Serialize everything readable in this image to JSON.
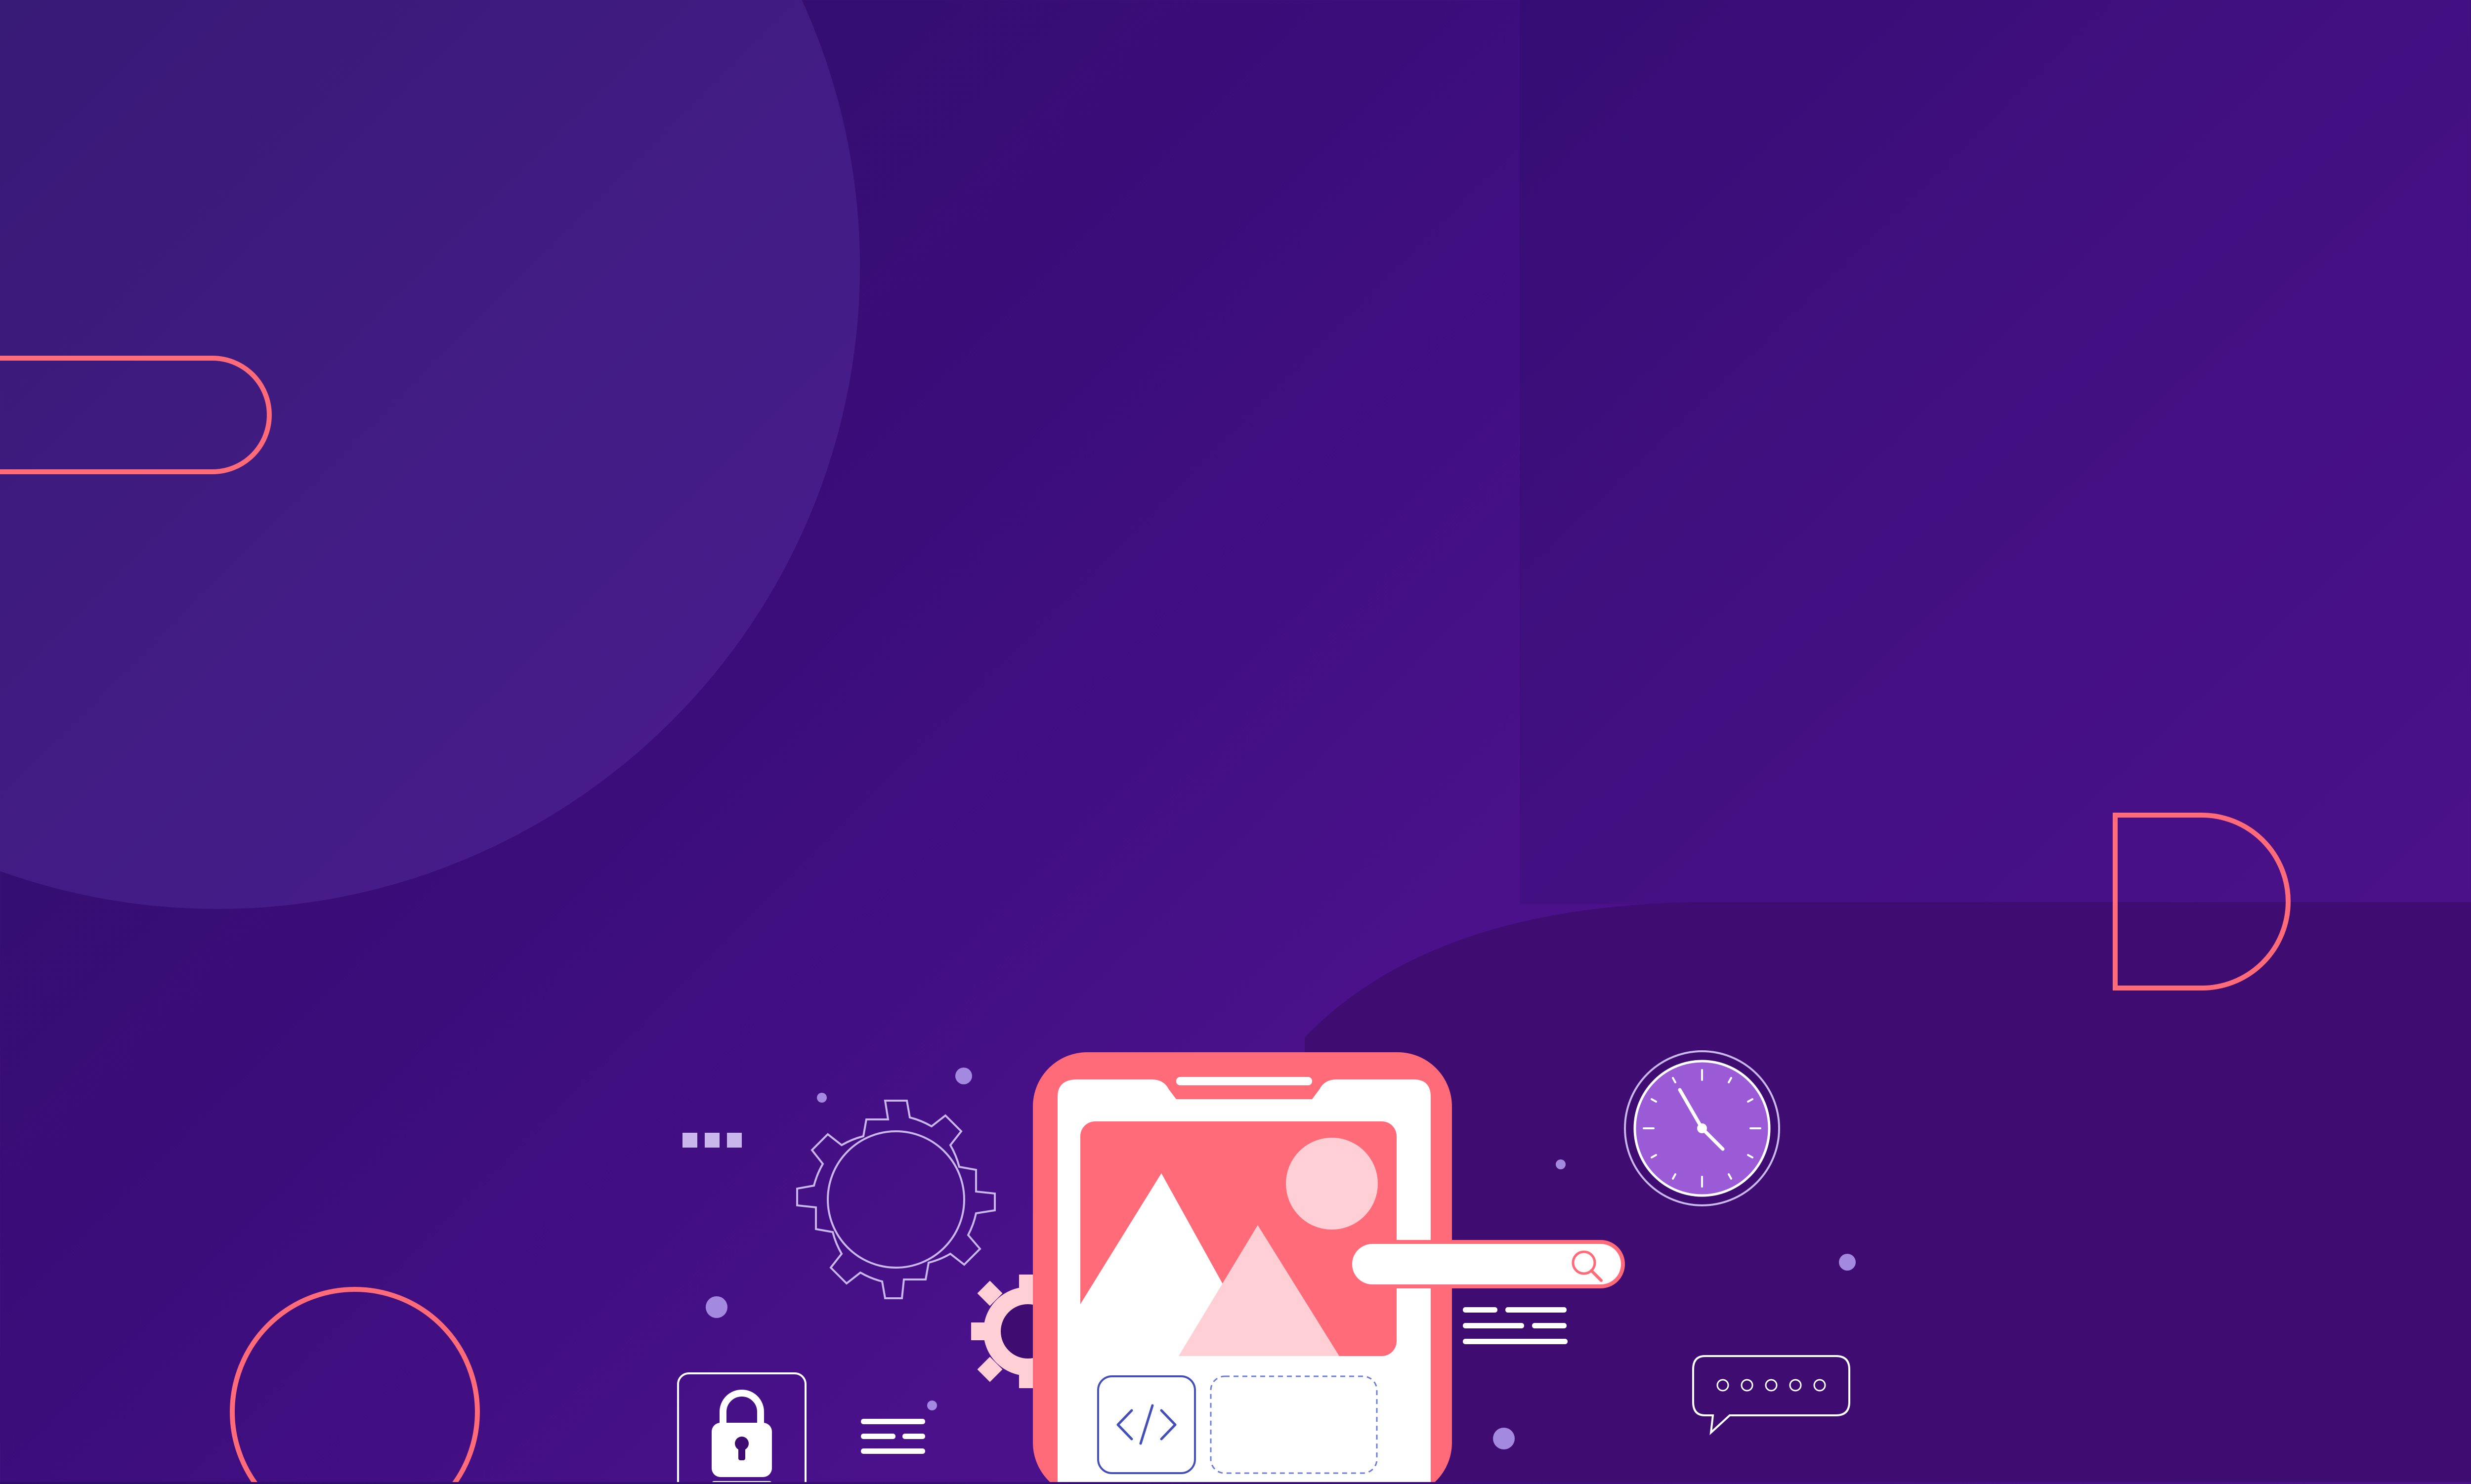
{
  "colors": {
    "bg_dark": "#2b0f66",
    "bg_mid": "#3a0d7a",
    "bg_light": "#4a118b",
    "circle_fill": "#4a1e8e",
    "lower_panel": "#3f0c72",
    "coral": "#ff6b78",
    "pink_light": "#ffcfd6",
    "white": "#ffffff",
    "clock_face": "#9b5bd6",
    "dot_lavender": "#a389e0"
  },
  "illustration": {
    "phone": {
      "has_mountain_image": true,
      "tiles": [
        "code-tile",
        "empty-dashed-tile"
      ],
      "search_bar": {
        "icon": "search-icon"
      }
    },
    "widgets": [
      "gear-icon",
      "clock-icon",
      "lock-icon",
      "chat-bubble-icon",
      "text-lines-icon"
    ],
    "chat_bubble": {
      "dots": 5
    },
    "loading_squares": 3
  }
}
